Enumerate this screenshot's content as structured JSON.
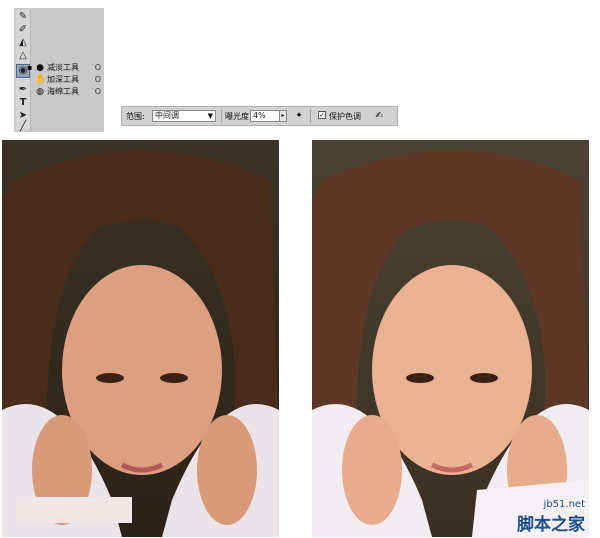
{
  "tool_panel": {
    "flyout": [
      {
        "label": "减淡工具",
        "key": "O",
        "icon": "dodge-icon"
      },
      {
        "label": "加深工具",
        "key": "O",
        "icon": "burn-icon"
      },
      {
        "label": "海绵工具",
        "key": "O",
        "icon": "sponge-icon"
      }
    ],
    "active_tool_icon": "magnifier-dodge-icon"
  },
  "options_bar": {
    "range_label": "范围:",
    "range_value": "中间调",
    "exposure_label": "曝光度:",
    "exposure_value": "4%",
    "protect_tones_label": "保护色调",
    "protect_tones_checked": true
  },
  "watermark": {
    "site": "jb51.net",
    "text": "脚本之家"
  },
  "colors": {
    "panel_bg": "#c9c9c9",
    "toolbar_bg": "#d2d2d2",
    "watermark_blue": "#1a4f8a"
  }
}
